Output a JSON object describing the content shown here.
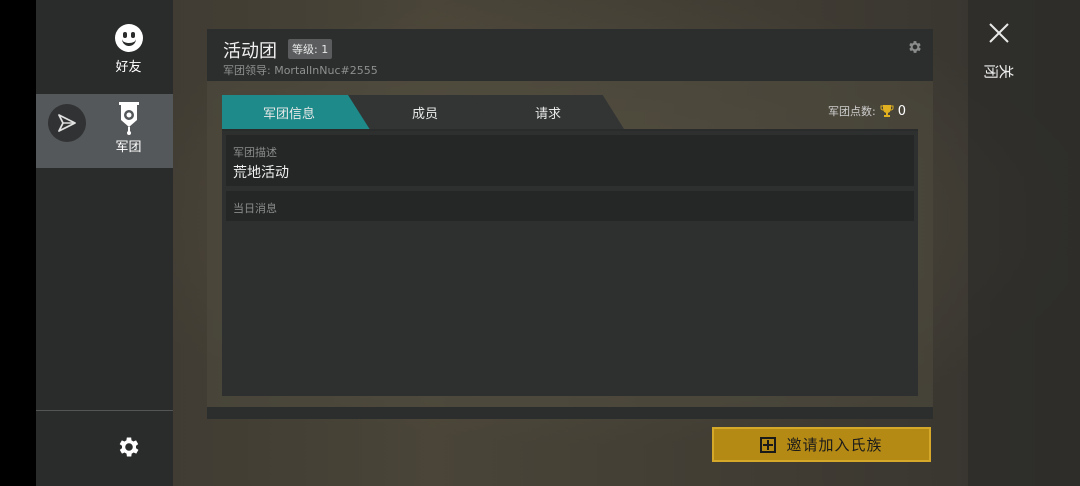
{
  "sidebar": {
    "friends_label": "好友",
    "clan_label": "军团",
    "friends_icon": "smiley-face-icon",
    "clan_icon": "clan-banner-icon",
    "send_icon": "send-icon",
    "settings_icon": "gear-icon"
  },
  "header": {
    "clan_name": "活动团",
    "level": "等级: 1",
    "leader": "军团领导: MortalInNuc#2555"
  },
  "tabs": [
    {
      "label": "军团信息",
      "active": true
    },
    {
      "label": "成员",
      "active": false
    },
    {
      "label": "请求",
      "active": false
    }
  ],
  "points": {
    "label": "军团点数:",
    "value": "0",
    "icon": "trophy-icon"
  },
  "info": {
    "description_label": "军团描述",
    "description_value": "荒地活动",
    "motd_label": "当日消息"
  },
  "invite_button": {
    "label": "邀请加入氏族",
    "icon": "plus-box-icon"
  },
  "close": {
    "label": "关闭",
    "icon": "close-icon"
  },
  "colors": {
    "active_tab": "#1e8a8a",
    "button_gold": "#b58a14",
    "trophy_gold": "#e0b020"
  }
}
